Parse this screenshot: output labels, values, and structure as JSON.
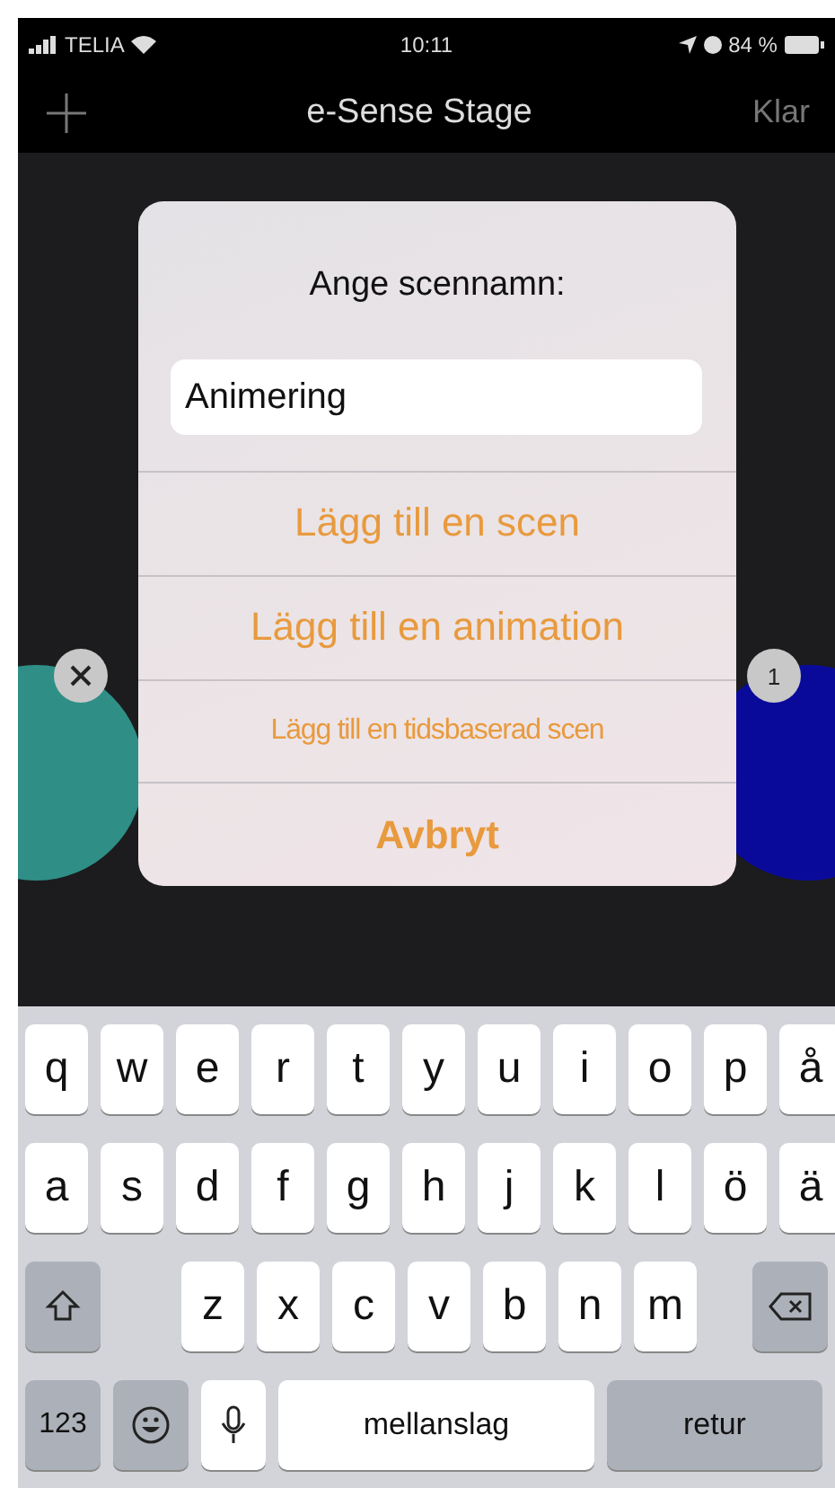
{
  "status_bar": {
    "carrier": "TELIA",
    "time": "10:11",
    "battery": "84 %"
  },
  "nav_bar": {
    "title": "e-Sense Stage",
    "done": "Klar"
  },
  "background_items": [
    {
      "color": "#2f8f86",
      "badge": {
        "kind": "close"
      }
    },
    {
      "color": "#0a0a9a",
      "badge": {
        "kind": "count",
        "label": "1"
      }
    }
  ],
  "dialog": {
    "title": "Ange scennamn:",
    "input": {
      "value": "Animering"
    },
    "actions": [
      {
        "label": "Lägg till en scen",
        "kind": "normal"
      },
      {
        "label": "Lägg till en animation",
        "kind": "normal"
      },
      {
        "label": "Lägg till en tidsbaserad scen",
        "kind": "small"
      },
      {
        "label": "Avbryt",
        "kind": "cancel"
      }
    ]
  },
  "keyboard": {
    "top_row": [
      "q",
      "w",
      "e",
      "r",
      "t",
      "y",
      "u",
      "i",
      "o",
      "p",
      "å"
    ],
    "middle_row": [
      "a",
      "s",
      "d",
      "f",
      "g",
      "h",
      "j",
      "k",
      "l",
      "ö",
      "ä"
    ],
    "bottom_row": [
      "z",
      "x",
      "c",
      "v",
      "b",
      "n",
      "m"
    ],
    "numbers": "123",
    "space": "mellanslag",
    "return": "retur"
  }
}
